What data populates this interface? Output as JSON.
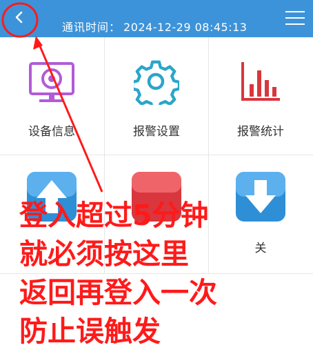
{
  "header": {
    "comm_label": "通讯时间：",
    "comm_time": "2024-12-29 08:45:13",
    "background_color": "#3d93d9",
    "back_icon": "chevron-left-icon",
    "menu_icon": "hamburger-menu-icon"
  },
  "grid": {
    "row1": [
      {
        "label": "设备信息",
        "icon": "monitor-camera-icon",
        "color": "#b25ad8"
      },
      {
        "label": "报警设置",
        "icon": "gear-icon",
        "color": "#2aa6c9"
      },
      {
        "label": "报警统计",
        "icon": "bar-chart-icon",
        "color": "#d9363e"
      }
    ],
    "row2": [
      {
        "label": "",
        "icon": "up-arrow-icon",
        "color": "#2e8fd6"
      },
      {
        "label": "",
        "icon": "red-block-icon",
        "color": "#d9363e"
      },
      {
        "label": "关",
        "icon": "down-arrow-icon",
        "color": "#2e8fd6"
      }
    ]
  },
  "annotation": {
    "lines": [
      "登入超过5分钟",
      "就必须按这里",
      "返回再登入一次",
      "防止误触发"
    ],
    "color": "#ff1a1a"
  }
}
